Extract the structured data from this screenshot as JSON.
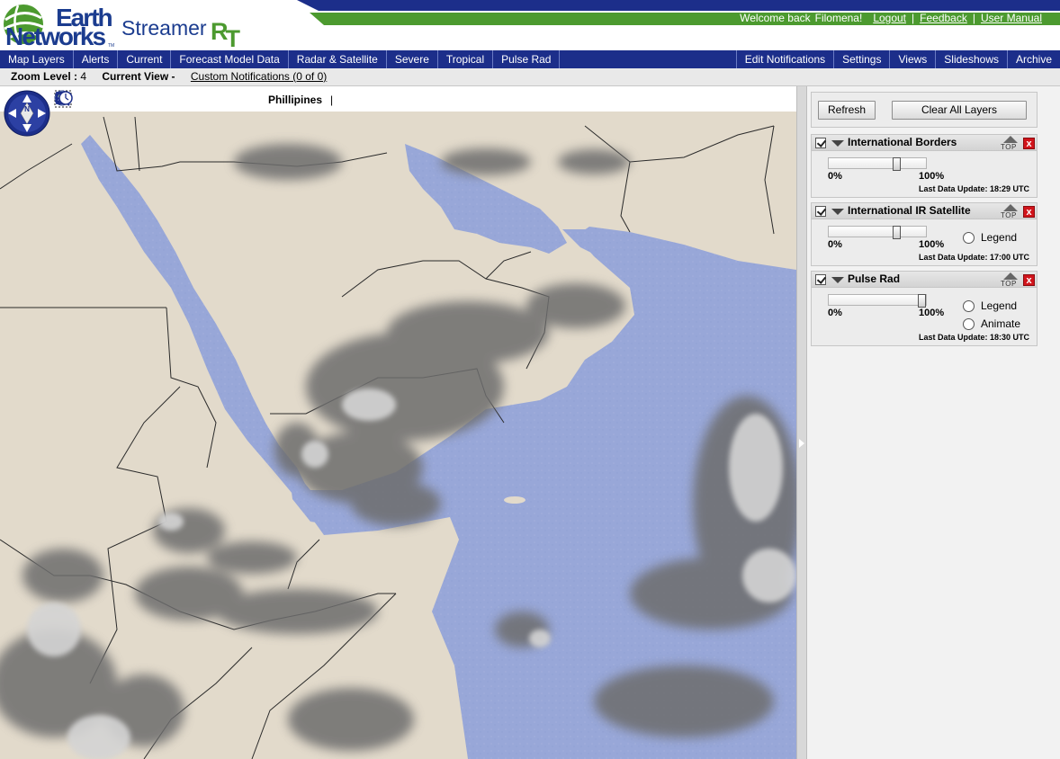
{
  "brand": {
    "earth": "Earth",
    "networks": "Networks",
    "tm": "TM",
    "product": "Streamer",
    "product_suffix_r": "R",
    "product_suffix_t": "T",
    "colors": {
      "navy": "#1c2e8a",
      "green": "#4c9a2f"
    }
  },
  "welcome": {
    "greeting": "Welcome back",
    "user": "Filomena!",
    "links": [
      "Logout",
      "Feedback",
      "User Manual"
    ]
  },
  "nav": {
    "left": [
      "Map Layers",
      "Alerts",
      "Current",
      "Forecast Model Data",
      "Radar & Satellite",
      "Severe",
      "Tropical",
      "Pulse Rad"
    ],
    "right": [
      "Edit Notifications",
      "Settings",
      "Views",
      "Slideshows",
      "Archive"
    ]
  },
  "zoombar": {
    "zoom_label": "Zoom Level :",
    "zoom_value": "4",
    "view_label": "Current View -",
    "view_value": "",
    "notifications": "Custom Notifications (0 of 0)"
  },
  "map": {
    "location": "Phillipines",
    "caret": "|",
    "tools": [
      "zoom-in-icon",
      "zoom-out-icon",
      "zoom-box-icon",
      "globe-icon",
      "ruler-icon",
      "line-icon",
      "circle-icon",
      "square-icon",
      "clock-icon"
    ],
    "compass_letter": "N",
    "colors": {
      "land": "#e2dacb",
      "water": "#98a7d8",
      "cloud": "#6e6e6e"
    }
  },
  "panel": {
    "refresh": "Refresh",
    "clear": "Clear All Layers",
    "layers": [
      {
        "title": "International Borders",
        "opacity_pct": 72,
        "min": "0%",
        "max": "100%",
        "update_label": "Last Data Update:",
        "update_time": "18:29 UTC",
        "options": []
      },
      {
        "title": "International IR Satellite",
        "opacity_pct": 72,
        "min": "0%",
        "max": "100%",
        "update_label": "Last Data Update:",
        "update_time": "17:00 UTC",
        "options": [
          "Legend"
        ]
      },
      {
        "title": "Pulse Rad",
        "opacity_pct": 100,
        "min": "0%",
        "max": "100%",
        "update_label": "Last Data Update:",
        "update_time": "18:30 UTC",
        "options": [
          "Legend",
          "Animate"
        ]
      }
    ],
    "top_label": "TOP",
    "close_label": "x"
  }
}
